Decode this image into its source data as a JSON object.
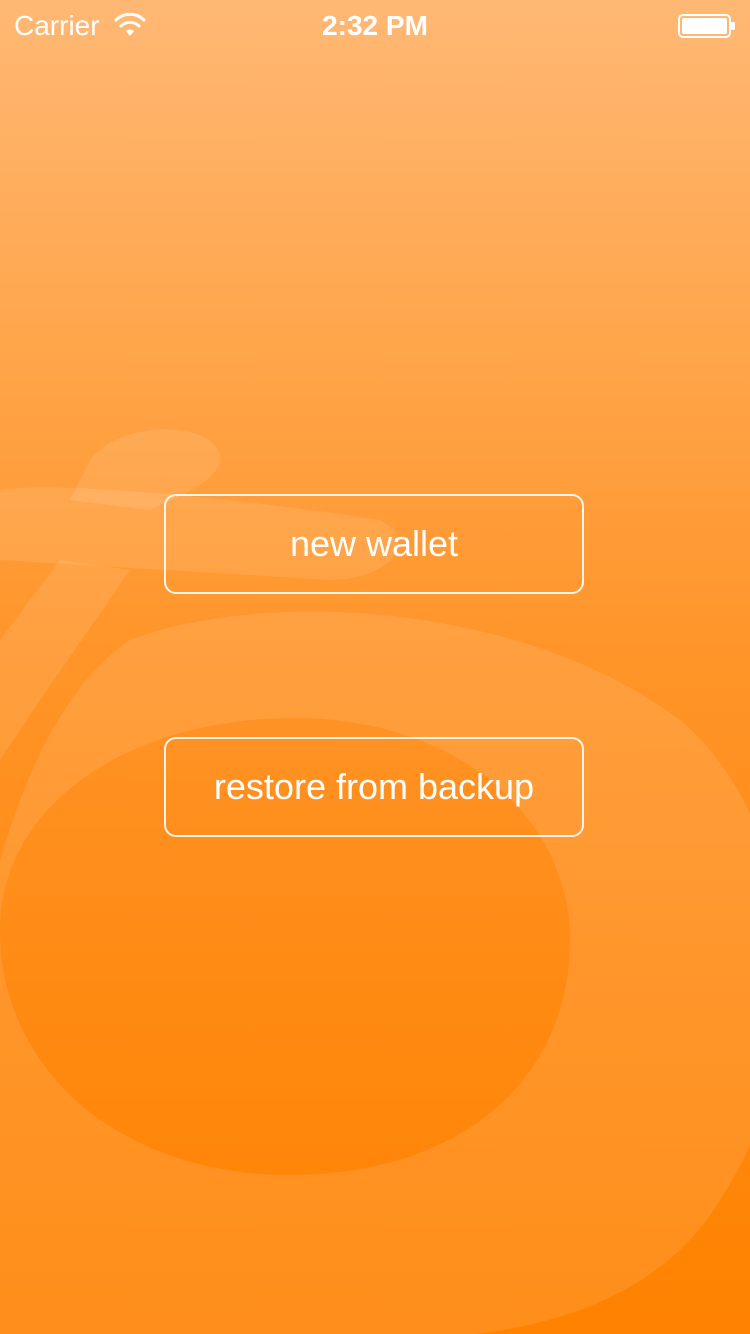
{
  "status_bar": {
    "carrier": "Carrier",
    "time": "2:32 PM",
    "icons": [
      "wifi-icon",
      "battery-icon"
    ]
  },
  "actions": {
    "new_wallet_label": "new wallet",
    "restore_label": "restore from backup"
  },
  "colors": {
    "background_top": "#ffb874",
    "background_bottom": "#ff8200",
    "button_border": "#ffffff",
    "text": "#ffffff"
  }
}
